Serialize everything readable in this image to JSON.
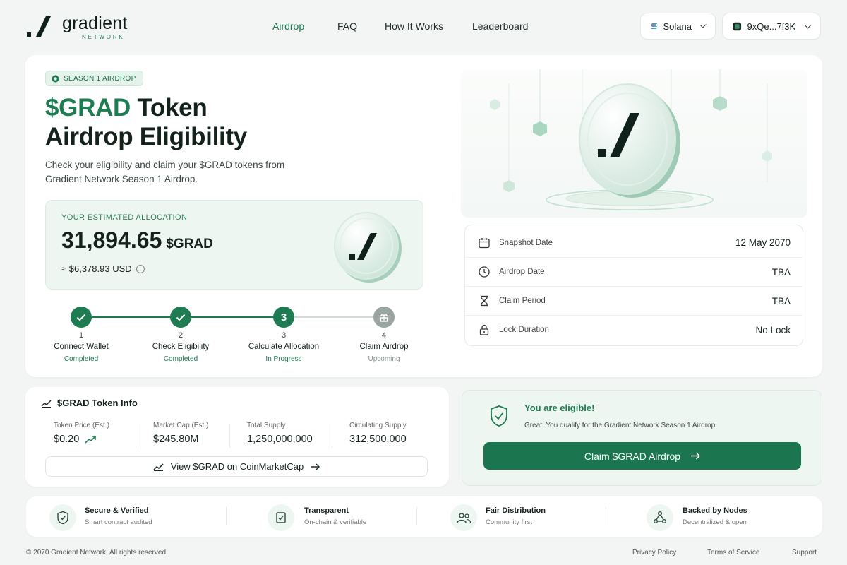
{
  "brand": {
    "name": "gradient",
    "sub": "NETWORK",
    "accent": "#1e7b52"
  },
  "nav": {
    "items": [
      "Airdrop",
      "FAQ",
      "How It Works",
      "Leaderboard"
    ],
    "active": "Airdrop"
  },
  "network": {
    "label": "Solana",
    "icon": "solana-icon"
  },
  "wallet": {
    "label": "9xQe...7f3K",
    "icon": "wallet-icon"
  },
  "hero": {
    "badge": "SEASON 1 AIRDROP",
    "title_green": "$GRAD",
    "title_rest1": " Token",
    "title_line2": "Airdrop Eligibility",
    "lead": "Check your eligibility and claim your $GRAD tokens from Gradient Network Season 1 Airdrop."
  },
  "allocation": {
    "label": "YOUR ESTIMATED ALLOCATION",
    "amount": "31,894.65",
    "unit": "$GRAD",
    "usd": "≈ $6,378.93 USD"
  },
  "steps": [
    {
      "num": "1",
      "title": "Connect Wallet",
      "status": "Completed",
      "state": "done"
    },
    {
      "num": "2",
      "title": "Check Eligibility",
      "status": "Completed",
      "state": "done"
    },
    {
      "num": "3",
      "title": "Calculate Allocation",
      "status": "In Progress",
      "state": "active"
    },
    {
      "num": "4",
      "title": "Claim Airdrop",
      "status": "Upcoming",
      "state": "upcoming"
    }
  ],
  "dates": [
    {
      "label": "Snapshot Date",
      "value": "12 May 2070",
      "icon": "calendar-icon"
    },
    {
      "label": "Airdrop Date",
      "value": "TBA",
      "icon": "clock-icon"
    },
    {
      "label": "Claim Period",
      "value": "TBA",
      "icon": "hourglass-icon"
    },
    {
      "label": "Lock Duration",
      "value": "No Lock",
      "icon": "lock-icon"
    }
  ],
  "token_info": {
    "title": "$GRAD Token Info",
    "cols": [
      {
        "label": "Token Price (Est.)",
        "value": "$0.20"
      },
      {
        "label": "Market Cap (Est.)",
        "value": "$245.80M"
      },
      {
        "label": "Total Supply",
        "value": "1,250,000,000"
      },
      {
        "label": "Circulating Supply",
        "value": "312,500,000"
      }
    ],
    "cmc_label": "View $GRAD on CoinMarketCap"
  },
  "eligible": {
    "title": "You are eligible!",
    "sub": "Great! You qualify for the Gradient Network Season 1 Airdrop.",
    "button": "Claim $GRAD Airdrop"
  },
  "features": [
    {
      "title": "Secure & Verified",
      "sub": "Smart contract audited",
      "icon": "shield-check-icon"
    },
    {
      "title": "Transparent",
      "sub": "On-chain & verifiable",
      "icon": "document-check-icon"
    },
    {
      "title": "Fair Distribution",
      "sub": "Community first",
      "icon": "users-icon"
    },
    {
      "title": "Backed by Nodes",
      "sub": "Decentralized & open",
      "icon": "nodes-icon"
    }
  ],
  "footer": {
    "copyright": "© 2070 Gradient Network. All rights reserved.",
    "links": [
      "Privacy Policy",
      "Terms of Service",
      "Support"
    ]
  }
}
